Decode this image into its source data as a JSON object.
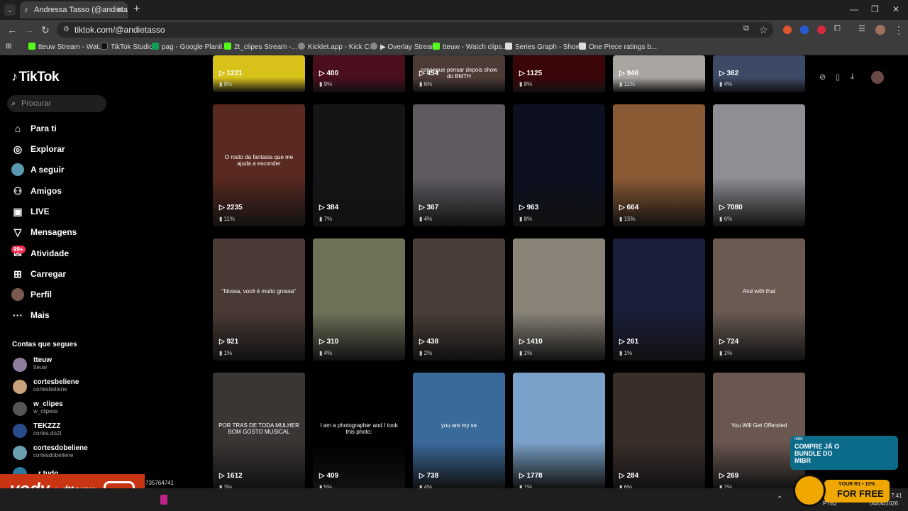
{
  "browser": {
    "tab_title": "Andressa Tasso (@andietasso) |",
    "url": "tiktok.com/@andietasso",
    "bookmarks": [
      {
        "label": "tteuw Stream - Wat...",
        "color": "#53fc18"
      },
      {
        "label": "TikTok Studio",
        "color": "#111111"
      },
      {
        "label": "pag - Google Planil...",
        "color": "#0f9d58"
      },
      {
        "label": "2t_clipes Stream -...",
        "color": "#53fc18"
      },
      {
        "label": "Kicklet.app - Kick C...",
        "color": "#888888"
      },
      {
        "label": "▶ Overlay Stream",
        "color": "#888888"
      },
      {
        "label": "tteuw - Watch clips...",
        "color": "#53fc18"
      },
      {
        "label": "Series Graph - Show...",
        "color": "#dddddd"
      },
      {
        "label": "One Piece ratings b...",
        "color": "#dddddd"
      }
    ]
  },
  "sidebar": {
    "logo": "TikTok",
    "search_placeholder": "Procurar",
    "nav": [
      {
        "label": "Para ti",
        "icon": "home-icon"
      },
      {
        "label": "Explorar",
        "icon": "compass-icon"
      },
      {
        "label": "A seguir",
        "icon": "avatar-icon"
      },
      {
        "label": "Amigos",
        "icon": "friends-icon"
      },
      {
        "label": "LIVE",
        "icon": "live-icon"
      },
      {
        "label": "Mensagens",
        "icon": "message-icon"
      },
      {
        "label": "Atividade",
        "icon": "activity-icon"
      },
      {
        "label": "Carregar",
        "icon": "upload-icon"
      },
      {
        "label": "Perfil",
        "icon": "profile-icon"
      },
      {
        "label": "Mais",
        "icon": "more-icon"
      }
    ],
    "activity_badge": "99+",
    "following_heading": "Contas que segues",
    "following": [
      {
        "name": "tteuw",
        "handle": "tteuw",
        "color": "#8e7d9e"
      },
      {
        "name": "cortesbeliene",
        "handle": "cortesbeliene",
        "color": "#c9a27a"
      },
      {
        "name": "w_clipes",
        "handle": "w_clipess",
        "color": "#555555"
      },
      {
        "name": "TEKZZZ",
        "handle": "cortes.do2t",
        "color": "#2a4a8a"
      },
      {
        "name": "cortesdobeliene",
        "handle": "cortesdobeliene",
        "color": "#6aa0b0"
      }
    ],
    "partial_item": "r tudo"
  },
  "videos": [
    {
      "views": "1221",
      "pct": "8%",
      "bg": "#d8c21a",
      "caption": ""
    },
    {
      "views": "400",
      "pct": "9%",
      "bg": "#4a0e1c",
      "caption": ""
    },
    {
      "views": "454",
      "pct": "6%",
      "bg": "#4d3b36",
      "caption": "consegue pensar depois show do BMTH"
    },
    {
      "views": "1125",
      "pct": "8%",
      "bg": "#3a0608",
      "caption": ""
    },
    {
      "views": "946",
      "pct": "11%",
      "bg": "#a9a6a2",
      "caption": ""
    },
    {
      "views": "362",
      "pct": "4%",
      "bg": "#3c4a66",
      "caption": ""
    },
    {
      "views": "2235",
      "pct": "11%",
      "bg": "#5a2a22",
      "caption": "O rosto da fantasia que me ajuda a esconder"
    },
    {
      "views": "384",
      "pct": "7%",
      "bg": "#151518",
      "caption": ""
    },
    {
      "views": "367",
      "pct": "4%",
      "bg": "#5e5a60",
      "caption": ""
    },
    {
      "views": "963",
      "pct": "8%",
      "bg": "#0c1020",
      "caption": ""
    },
    {
      "views": "664",
      "pct": "15%",
      "bg": "#8a5a34",
      "caption": ""
    },
    {
      "views": "7080",
      "pct": "6%",
      "bg": "#8e8e94",
      "caption": ""
    },
    {
      "views": "921",
      "pct": "1%",
      "bg": "#4a3a36",
      "caption": "\"Nossa, você é muito grossa\""
    },
    {
      "views": "310",
      "pct": "4%",
      "bg": "#6e7258",
      "caption": ""
    },
    {
      "views": "438",
      "pct": "2%",
      "bg": "#4a3e38",
      "caption": ""
    },
    {
      "views": "1410",
      "pct": "1%",
      "bg": "#8a8478",
      "caption": ""
    },
    {
      "views": "261",
      "pct": "1%",
      "bg": "#1a1e3a",
      "caption": ""
    },
    {
      "views": "724",
      "pct": "1%",
      "bg": "#6a5a52",
      "caption": "And with that"
    },
    {
      "views": "1612",
      "pct": "3%",
      "bg": "#3a3634",
      "caption": "POR TRAS DE TODA MULHER BOM GOSTO MUSICAL"
    },
    {
      "views": "409",
      "pct": "5%",
      "bg": "#000000",
      "caption": "I am a photographer and I took this photo:"
    },
    {
      "views": "738",
      "pct": "4%",
      "bg": "#3a6a9a",
      "caption": "you are my se"
    },
    {
      "views": "1778",
      "pct": "1%",
      "bg": "#7aa2c8",
      "caption": ""
    },
    {
      "views": "284",
      "pct": "6%",
      "bg": "#3a2e2a",
      "caption": ""
    },
    {
      "views": "269",
      "pct": "2%",
      "bg": "#6a5850",
      "caption": "You Will Get Offended"
    }
  ],
  "overlays": {
    "vody_brand": "vody",
    "vody_tld": ".GG",
    "vody_user": "/tteuw",
    "ad_small": "mibr",
    "ad_text": "COMPRE JÁ O BUNDLE DO MIBR",
    "ff_line1": "YOUR R1 • 10%",
    "ff_line2": "FOR FREE",
    "taskbar_lang": "PTB2",
    "taskbar_time": "7:41",
    "taskbar_date": "04/04/2026",
    "partial_id": "735764741"
  }
}
